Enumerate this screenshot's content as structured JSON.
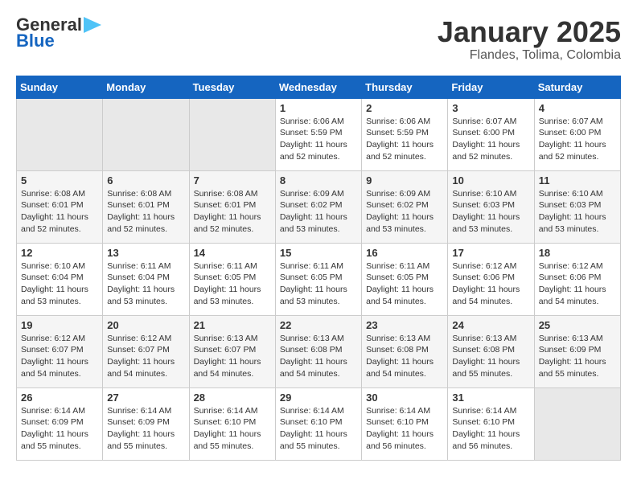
{
  "header": {
    "logo_general": "General",
    "logo_blue": "Blue",
    "title": "January 2025",
    "subtitle": "Flandes, Tolima, Colombia"
  },
  "days_of_week": [
    "Sunday",
    "Monday",
    "Tuesday",
    "Wednesday",
    "Thursday",
    "Friday",
    "Saturday"
  ],
  "weeks": [
    [
      {
        "day": "",
        "info": ""
      },
      {
        "day": "",
        "info": ""
      },
      {
        "day": "",
        "info": ""
      },
      {
        "day": "1",
        "info": "Sunrise: 6:06 AM\nSunset: 5:59 PM\nDaylight: 11 hours\nand 52 minutes."
      },
      {
        "day": "2",
        "info": "Sunrise: 6:06 AM\nSunset: 5:59 PM\nDaylight: 11 hours\nand 52 minutes."
      },
      {
        "day": "3",
        "info": "Sunrise: 6:07 AM\nSunset: 6:00 PM\nDaylight: 11 hours\nand 52 minutes."
      },
      {
        "day": "4",
        "info": "Sunrise: 6:07 AM\nSunset: 6:00 PM\nDaylight: 11 hours\nand 52 minutes."
      }
    ],
    [
      {
        "day": "5",
        "info": "Sunrise: 6:08 AM\nSunset: 6:01 PM\nDaylight: 11 hours\nand 52 minutes."
      },
      {
        "day": "6",
        "info": "Sunrise: 6:08 AM\nSunset: 6:01 PM\nDaylight: 11 hours\nand 52 minutes."
      },
      {
        "day": "7",
        "info": "Sunrise: 6:08 AM\nSunset: 6:01 PM\nDaylight: 11 hours\nand 52 minutes."
      },
      {
        "day": "8",
        "info": "Sunrise: 6:09 AM\nSunset: 6:02 PM\nDaylight: 11 hours\nand 53 minutes."
      },
      {
        "day": "9",
        "info": "Sunrise: 6:09 AM\nSunset: 6:02 PM\nDaylight: 11 hours\nand 53 minutes."
      },
      {
        "day": "10",
        "info": "Sunrise: 6:10 AM\nSunset: 6:03 PM\nDaylight: 11 hours\nand 53 minutes."
      },
      {
        "day": "11",
        "info": "Sunrise: 6:10 AM\nSunset: 6:03 PM\nDaylight: 11 hours\nand 53 minutes."
      }
    ],
    [
      {
        "day": "12",
        "info": "Sunrise: 6:10 AM\nSunset: 6:04 PM\nDaylight: 11 hours\nand 53 minutes."
      },
      {
        "day": "13",
        "info": "Sunrise: 6:11 AM\nSunset: 6:04 PM\nDaylight: 11 hours\nand 53 minutes."
      },
      {
        "day": "14",
        "info": "Sunrise: 6:11 AM\nSunset: 6:05 PM\nDaylight: 11 hours\nand 53 minutes."
      },
      {
        "day": "15",
        "info": "Sunrise: 6:11 AM\nSunset: 6:05 PM\nDaylight: 11 hours\nand 53 minutes."
      },
      {
        "day": "16",
        "info": "Sunrise: 6:11 AM\nSunset: 6:05 PM\nDaylight: 11 hours\nand 54 minutes."
      },
      {
        "day": "17",
        "info": "Sunrise: 6:12 AM\nSunset: 6:06 PM\nDaylight: 11 hours\nand 54 minutes."
      },
      {
        "day": "18",
        "info": "Sunrise: 6:12 AM\nSunset: 6:06 PM\nDaylight: 11 hours\nand 54 minutes."
      }
    ],
    [
      {
        "day": "19",
        "info": "Sunrise: 6:12 AM\nSunset: 6:07 PM\nDaylight: 11 hours\nand 54 minutes."
      },
      {
        "day": "20",
        "info": "Sunrise: 6:12 AM\nSunset: 6:07 PM\nDaylight: 11 hours\nand 54 minutes."
      },
      {
        "day": "21",
        "info": "Sunrise: 6:13 AM\nSunset: 6:07 PM\nDaylight: 11 hours\nand 54 minutes."
      },
      {
        "day": "22",
        "info": "Sunrise: 6:13 AM\nSunset: 6:08 PM\nDaylight: 11 hours\nand 54 minutes."
      },
      {
        "day": "23",
        "info": "Sunrise: 6:13 AM\nSunset: 6:08 PM\nDaylight: 11 hours\nand 54 minutes."
      },
      {
        "day": "24",
        "info": "Sunrise: 6:13 AM\nSunset: 6:08 PM\nDaylight: 11 hours\nand 55 minutes."
      },
      {
        "day": "25",
        "info": "Sunrise: 6:13 AM\nSunset: 6:09 PM\nDaylight: 11 hours\nand 55 minutes."
      }
    ],
    [
      {
        "day": "26",
        "info": "Sunrise: 6:14 AM\nSunset: 6:09 PM\nDaylight: 11 hours\nand 55 minutes."
      },
      {
        "day": "27",
        "info": "Sunrise: 6:14 AM\nSunset: 6:09 PM\nDaylight: 11 hours\nand 55 minutes."
      },
      {
        "day": "28",
        "info": "Sunrise: 6:14 AM\nSunset: 6:10 PM\nDaylight: 11 hours\nand 55 minutes."
      },
      {
        "day": "29",
        "info": "Sunrise: 6:14 AM\nSunset: 6:10 PM\nDaylight: 11 hours\nand 55 minutes."
      },
      {
        "day": "30",
        "info": "Sunrise: 6:14 AM\nSunset: 6:10 PM\nDaylight: 11 hours\nand 56 minutes."
      },
      {
        "day": "31",
        "info": "Sunrise: 6:14 AM\nSunset: 6:10 PM\nDaylight: 11 hours\nand 56 minutes."
      },
      {
        "day": "",
        "info": ""
      }
    ]
  ]
}
